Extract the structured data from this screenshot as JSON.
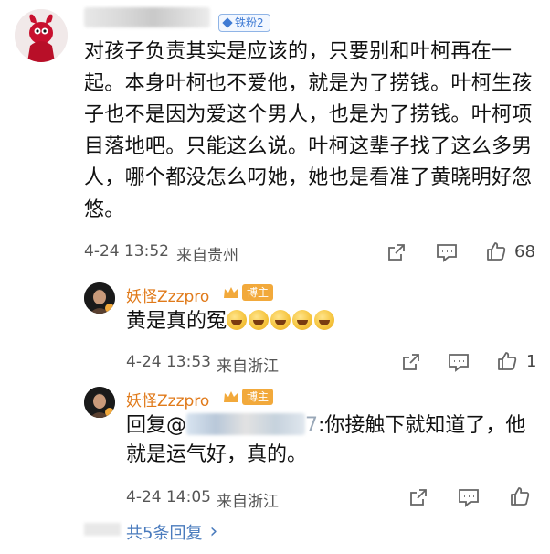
{
  "main_comment": {
    "fan_badge": "铁粉2",
    "text": "对孩子负责其实是应该的，只要别和叶柯再在一起。本身叶柯也不爱他，就是为了捞钱。叶柯生孩子也不是因为爱这个男人，也是为了捞钱。叶柯项目落地吧。只能这么说。叶柯这辈子找了这么多男人，哪个都没怎么叼她，她也是看准了黄晓明好忽悠。",
    "time": "4-24 13:52",
    "location": "来自贵州",
    "like_count": "68"
  },
  "replies": [
    {
      "username": "妖怪Zzzpro",
      "badge": "博主",
      "text": "黄是真的冤",
      "time": "4-24 13:53",
      "location": "来自浙江",
      "like_count": "1"
    },
    {
      "username": "妖怪Zzzpro",
      "badge": "博主",
      "reply_prefix": "回复@",
      "mention_suffix": "7",
      "text": ":你接触下就知道了，他就是运气好，真的。",
      "time": "4-24 14:05",
      "location": "来自浙江",
      "like_count": ""
    }
  ],
  "more_replies": {
    "label": "共5条回复",
    "chevron": "›"
  },
  "icons": {
    "share": "share-icon",
    "comment": "comment-icon",
    "like": "thumbs-up-icon"
  },
  "colors": {
    "username_orange": "#e07a1a",
    "link_blue": "#4a7bbd",
    "badge_orange": "#f2a93b",
    "fan_blue": "#3f7bd4"
  }
}
